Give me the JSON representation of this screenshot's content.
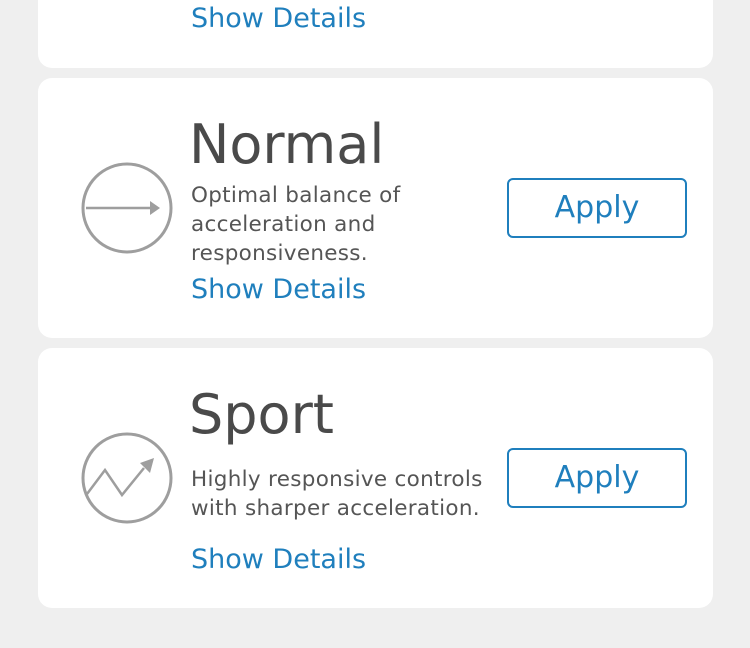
{
  "modes": {
    "previous": {
      "link": "Show Details"
    },
    "normal": {
      "icon": "straight-arrow-icon",
      "title": "Normal",
      "description": "Optimal balance of acceleration and responsiveness.",
      "link": "Show Details",
      "button": "Apply"
    },
    "sport": {
      "icon": "zigzag-arrow-icon",
      "title": "Sport",
      "description": "Highly responsive controls with sharper acceleration.",
      "link": "Show Details",
      "button": "Apply"
    }
  },
  "colors": {
    "accent": "#1f7fbd",
    "background": "#efefef",
    "card": "#ffffff",
    "title": "#4a4a4a",
    "icon": "#9e9e9e"
  }
}
